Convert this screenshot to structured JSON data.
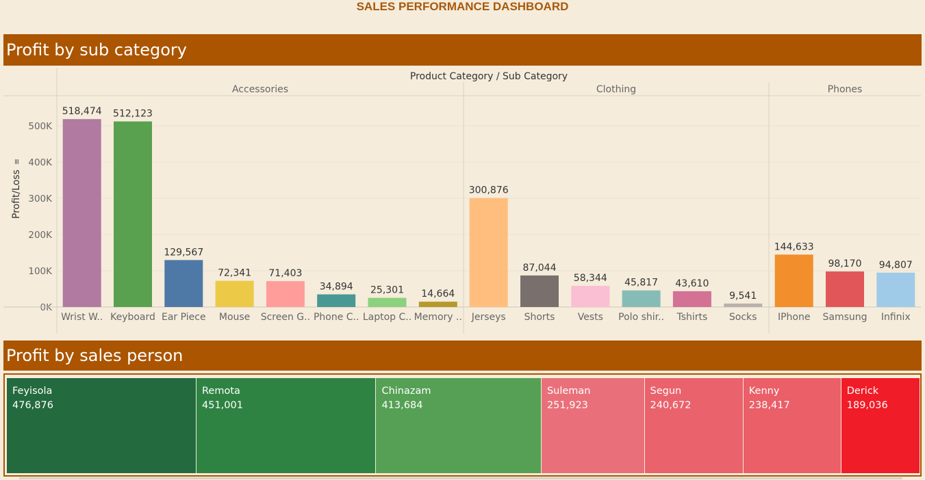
{
  "dashboard_title": "SALES PERFORMANCE DASHBOARD",
  "banner1_title": "Profit by sub category",
  "banner2_title": "Profit by sales person",
  "chart_data": {
    "type": "bar",
    "header": "Product Category / Sub Category",
    "ylabel": "Profit/Loss",
    "ylim": [
      -20000,
      590000
    ],
    "yticks": [
      0,
      100000,
      200000,
      300000,
      400000,
      500000
    ],
    "ytick_labels": [
      "0K",
      "100K",
      "200K",
      "300K",
      "400K",
      "500K"
    ],
    "groups": [
      {
        "name": "Accessories",
        "categories": [
          "Wrist W..",
          "Keyboard",
          "Ear Piece",
          "Mouse",
          "Screen G..",
          "Phone C..",
          "Laptop C..",
          "Memory .."
        ],
        "values": [
          518474,
          512123,
          129567,
          72341,
          71403,
          34894,
          25301,
          14664
        ],
        "value_labels": [
          "518,474",
          "512,123",
          "129,567",
          "72,341",
          "71,403",
          "34,894",
          "25,301",
          "14,664"
        ],
        "colors": [
          "#b07aa1",
          "#59a14f",
          "#4e79a7",
          "#edc948",
          "#ff9d9a",
          "#499894",
          "#8cd17d",
          "#b6992d"
        ]
      },
      {
        "name": "Clothing",
        "categories": [
          "Jerseys",
          "Shorts",
          "Vests",
          "Polo shir..",
          "Tshirts",
          "Socks"
        ],
        "values": [
          300876,
          87044,
          58344,
          45817,
          43610,
          9541
        ],
        "value_labels": [
          "300,876",
          "87,044",
          "58,344",
          "45,817",
          "43,610",
          "9,541"
        ],
        "colors": [
          "#ffbe7d",
          "#79706e",
          "#fabfd2",
          "#86bcb6",
          "#d37295",
          "#bab0ac"
        ]
      },
      {
        "name": "Phones",
        "categories": [
          "IPhone",
          "Samsung",
          "Infinix"
        ],
        "values": [
          144633,
          98170,
          94807
        ],
        "value_labels": [
          "144,633",
          "98,170",
          "94,807"
        ],
        "colors": [
          "#f28e2b",
          "#e15759",
          "#a0cbe8"
        ]
      }
    ]
  },
  "treemap": {
    "items": [
      {
        "name": "Feyisola",
        "value_label": "476,876",
        "value": 476876,
        "color": "#236a3e"
      },
      {
        "name": "Remota",
        "value_label": "451,001",
        "value": 451001,
        "color": "#2e8343"
      },
      {
        "name": "Chinazam",
        "value_label": "413,684",
        "value": 413684,
        "color": "#55a055"
      },
      {
        "name": "Suleman",
        "value_label": "251,923",
        "value": 251923,
        "color": "#e9707a"
      },
      {
        "name": "Segun",
        "value_label": "240,672",
        "value": 240672,
        "color": "#ea626c"
      },
      {
        "name": "Kenny",
        "value_label": "238,417",
        "value": 238417,
        "color": "#ea5f68"
      },
      {
        "name": "Derick",
        "value_label": "189,036",
        "value": 189036,
        "color": "#f01c27"
      }
    ]
  }
}
